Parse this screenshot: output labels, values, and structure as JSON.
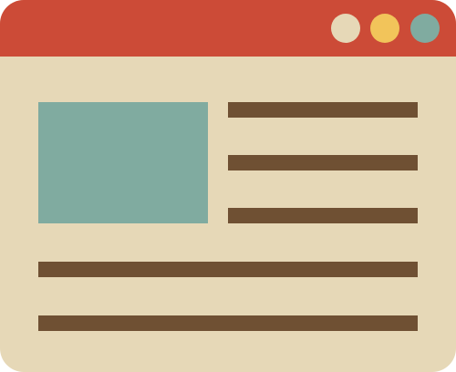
{
  "colors": {
    "frame": "#e6d8b7",
    "titlebar": "#cc4b37",
    "dots": [
      "#e6d8b7",
      "#f2c45a",
      "#80aba0"
    ],
    "image_placeholder": "#80aba0",
    "text_lines": "#6f5033"
  },
  "window": {
    "titlebar": {
      "controls": [
        {
          "icon": "window-control-dot-icon"
        },
        {
          "icon": "window-control-dot-icon"
        },
        {
          "icon": "window-control-dot-icon"
        }
      ]
    },
    "content": {
      "image_icon": "image-placeholder-icon",
      "text_line_icon": "text-line-icon",
      "side_lines": 3,
      "full_lines": 2
    }
  }
}
